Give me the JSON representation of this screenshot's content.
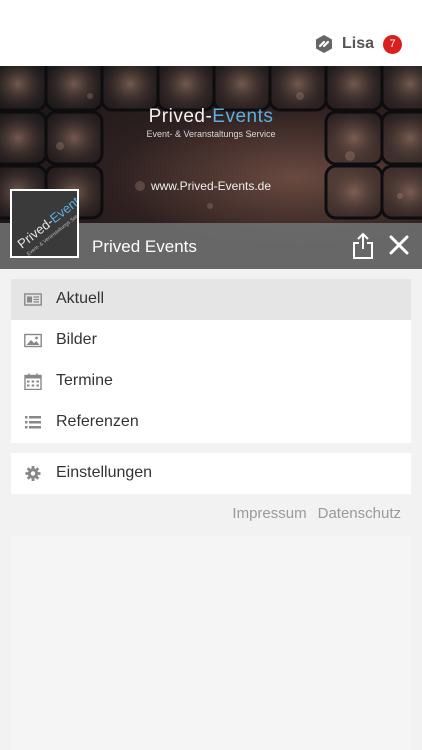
{
  "topbar": {
    "user_name": "Lisa",
    "notification_count": "7",
    "user_icon": "hexagon-link-icon",
    "badge_color": "#d9201f"
  },
  "banner": {
    "brand_part1": "Prived-",
    "brand_part2": "Events",
    "brand_subtitle": "Event- & Veranstaltungs Service",
    "url": "www.Prived-Events.de",
    "logo_part1": "Prived-",
    "logo_part2": "Events",
    "logo_subtitle": "Event- & Veranstaltungs Service",
    "title": "Prived Events",
    "accent_color": "#5eaee0",
    "share_icon": "share-icon",
    "close_icon": "close-icon"
  },
  "menu": {
    "items": [
      {
        "label": "Aktuell",
        "icon": "newspaper-icon",
        "active": true
      },
      {
        "label": "Bilder",
        "icon": "image-icon",
        "active": false
      },
      {
        "label": "Termine",
        "icon": "calendar-icon",
        "active": false
      },
      {
        "label": "Referenzen",
        "icon": "list-icon",
        "active": false
      }
    ],
    "settings": {
      "label": "Einstellungen",
      "icon": "gear-icon"
    }
  },
  "footer": {
    "impressum": "Impressum",
    "datenschutz": "Datenschutz"
  }
}
